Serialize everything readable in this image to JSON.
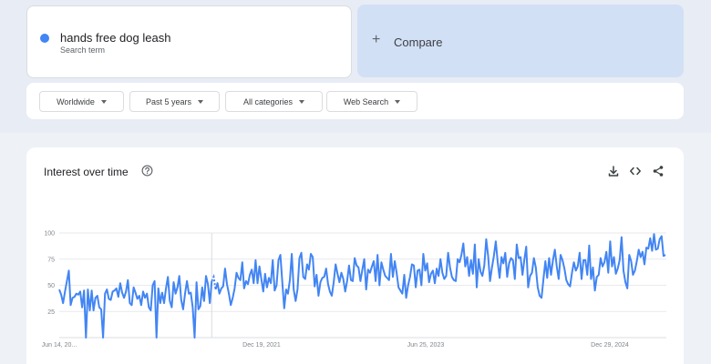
{
  "colors": {
    "series": "#4285f4",
    "compare_bg": "#d2e0f6"
  },
  "search_term": {
    "name": "hands free dog leash",
    "subtitle": "Search term"
  },
  "compare": {
    "plus": "+",
    "label": "Compare"
  },
  "filters": [
    {
      "label": "Worldwide"
    },
    {
      "label": "Past 5 years"
    },
    {
      "label": "All categories"
    },
    {
      "label": "Web Search"
    }
  ],
  "chart_panel": {
    "title": "Interest over time",
    "help_icon": "help-circle-icon",
    "tools": [
      "download-icon",
      "embed-code-icon",
      "share-icon"
    ]
  },
  "chart_data": {
    "type": "line",
    "title": "",
    "xlabel": "",
    "ylabel": "",
    "ylim": [
      0,
      100
    ],
    "y_ticks": [
      100,
      75,
      50,
      25
    ],
    "grid": true,
    "x_tick_labels": [
      "Jun 14, 20...",
      "Dec 19, 2021",
      "Jun 25, 2023",
      "Dec 29, 2024"
    ],
    "partial_data_start_index": 80,
    "series": [
      {
        "values": [
          46,
          41,
          33,
          44,
          54,
          64,
          31,
          38,
          39,
          42,
          41,
          44,
          29,
          45,
          0,
          46,
          26,
          45,
          26,
          38,
          40,
          29,
          27,
          0,
          42,
          46,
          37,
          36,
          44,
          45,
          47,
          39,
          52,
          43,
          38,
          44,
          55,
          33,
          31,
          48,
          43,
          37,
          40,
          31,
          44,
          38,
          42,
          29,
          26,
          50,
          54,
          0,
          47,
          33,
          43,
          33,
          47,
          58,
          35,
          29,
          53,
          42,
          48,
          59,
          36,
          27,
          42,
          54,
          42,
          43,
          29,
          0,
          53,
          27,
          30,
          48,
          35,
          59,
          51,
          33,
          54,
          58,
          46,
          52,
          42,
          47,
          49,
          66,
          51,
          42,
          31,
          38,
          47,
          62,
          57,
          55,
          72,
          47,
          54,
          51,
          60,
          65,
          52,
          74,
          52,
          68,
          56,
          44,
          61,
          48,
          57,
          52,
          74,
          45,
          50,
          74,
          79,
          53,
          28,
          46,
          42,
          55,
          80,
          46,
          35,
          46,
          76,
          81,
          58,
          56,
          70,
          65,
          80,
          77,
          49,
          60,
          40,
          53,
          57,
          58,
          66,
          51,
          44,
          40,
          53,
          70,
          61,
          53,
          62,
          56,
          44,
          54,
          69,
          55,
          54,
          76,
          69,
          67,
          54,
          65,
          75,
          46,
          65,
          62,
          68,
          73,
          54,
          79,
          50,
          72,
          65,
          59,
          57,
          55,
          80,
          58,
          73,
          62,
          48,
          45,
          42,
          60,
          38,
          50,
          58,
          70,
          69,
          48,
          64,
          65,
          50,
          80,
          64,
          71,
          53,
          61,
          64,
          52,
          66,
          59,
          75,
          62,
          56,
          59,
          81,
          67,
          58,
          55,
          54,
          75,
          72,
          79,
          90,
          68,
          77,
          59,
          74,
          61,
          89,
          48,
          75,
          63,
          59,
          69,
          94,
          78,
          54,
          67,
          78,
          92,
          72,
          57,
          77,
          71,
          81,
          58,
          71,
          76,
          74,
          56,
          89,
          76,
          77,
          60,
          75,
          87,
          48,
          59,
          62,
          76,
          67,
          48,
          40,
          38,
          56,
          73,
          57,
          76,
          60,
          74,
          84,
          68,
          56,
          79,
          74,
          66,
          55,
          51,
          49,
          62,
          72,
          64,
          68,
          81,
          56,
          74,
          74,
          60,
          88,
          56,
          67,
          45,
          58,
          60,
          76,
          68,
          72,
          82,
          62,
          92,
          68,
          77,
          61,
          66,
          74,
          96,
          64,
          53,
          47,
          79,
          73,
          60,
          64,
          73,
          84,
          77,
          82,
          70,
          86,
          85,
          95,
          83,
          99,
          84,
          85,
          94,
          97,
          78,
          79
        ]
      }
    ]
  }
}
